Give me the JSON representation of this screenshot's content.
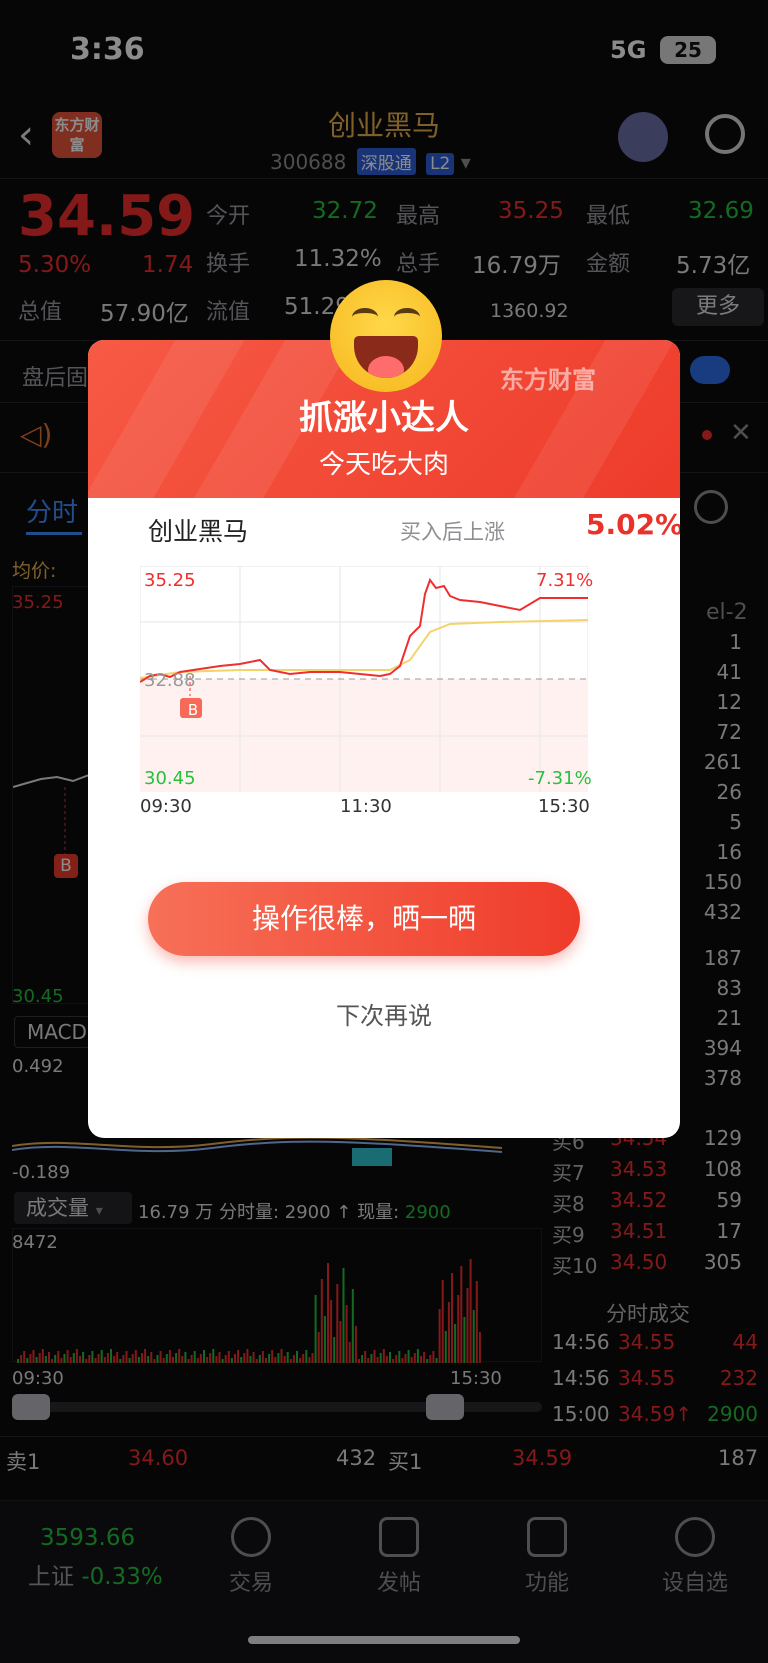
{
  "status": {
    "time": "3:36",
    "network": "5G",
    "battery": "25"
  },
  "header": {
    "brand_logo": "东方财富",
    "stock_name": "创业黑马",
    "code": "300688",
    "tag1": "深股通",
    "tag2": "L2"
  },
  "quote": {
    "price": "34.59",
    "change_pct": "5.30%",
    "change": "1.74",
    "open_label": "今开",
    "open": "32.72",
    "high_label": "最高",
    "high": "35.25",
    "low_label": "最低",
    "low": "32.69",
    "turnover_label": "换手",
    "turnover": "11.32%",
    "volume_label": "总手",
    "volume": "16.79万",
    "amount_label": "金额",
    "amount": "5.73亿",
    "mktcap_label": "总值",
    "mktcap": "57.90亿",
    "float_label": "流值",
    "float": "51.29",
    "pe_value": "1360.92",
    "more": "更多"
  },
  "after_hours": {
    "label": "盘后固"
  },
  "chart_tabs": {
    "active": "分时",
    "avg_label": "均价:",
    "level_tag": "el-2"
  },
  "left_chart": {
    "y_top": "35.25",
    "y_bottom": "30.45",
    "marker": "B",
    "macd_label": "MACD",
    "macd_top": "0.492",
    "macd_bottom": "-0.189",
    "vol_dropdown": "成交量",
    "vol_info_prefix": "16.79 万 分时量: 2900 ↑ 现量:",
    "vol_now": "2900",
    "vol_max": "8472",
    "t_start": "09:30",
    "t_end": "15:30"
  },
  "order_book_right": {
    "sell_vols": [
      "1",
      "41",
      "12",
      "72",
      "261",
      "26",
      "5",
      "16",
      "150",
      "432"
    ],
    "buy_vols": [
      "187",
      "83",
      "21",
      "394",
      "378"
    ],
    "buys": [
      {
        "label": "买6",
        "price": "34.54",
        "vol": "129"
      },
      {
        "label": "买7",
        "price": "34.53",
        "vol": "108"
      },
      {
        "label": "买8",
        "price": "34.52",
        "vol": "59"
      },
      {
        "label": "买9",
        "price": "34.51",
        "vol": "17"
      },
      {
        "label": "买10",
        "price": "34.50",
        "vol": "305"
      }
    ],
    "ticks_title": "分时成交",
    "ticks": [
      {
        "time": "14:56",
        "price": "34.55",
        "vol": "44"
      },
      {
        "time": "14:56",
        "price": "34.55",
        "vol": "232"
      },
      {
        "time": "15:00",
        "price": "34.59↑",
        "vol": "2900"
      }
    ]
  },
  "bottom_quote": {
    "sell1_label": "卖1",
    "sell1_price": "34.60",
    "sell1_vol": "432",
    "buy1_label": "买1",
    "buy1_price": "34.59",
    "buy1_vol": "187"
  },
  "bottom_nav": {
    "index_value": "3593.66",
    "index_label": "上证",
    "index_change": "-0.33%",
    "items": [
      "交易",
      "发帖",
      "功能",
      "设自选"
    ]
  },
  "modal": {
    "brand": "东方财富",
    "title": "抓涨小达人",
    "subtitle": "今天吃大肉",
    "stock": "创业黑马",
    "rise_label": "买入后上涨",
    "rise_value": "5.02%",
    "y_top": "35.25",
    "y_mid": "32.88",
    "y_bottom": "30.45",
    "pct_top": "7.31%",
    "pct_bottom": "-7.31%",
    "marker": "B",
    "t_start": "09:30",
    "t_mid": "11:30",
    "t_end": "15:30",
    "cta": "操作很棒，晒一晒",
    "later": "下次再说"
  },
  "colors": {
    "up": "#ef2f2f",
    "down": "#26c13d",
    "accent": "#ee3b2a",
    "gold": "#e7b04a"
  }
}
